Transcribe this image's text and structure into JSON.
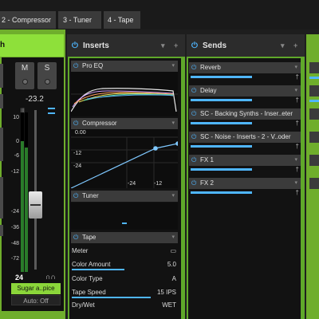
{
  "tabs": [
    {
      "label": "2 - Compressor"
    },
    {
      "label": "3 - Tuner"
    },
    {
      "label": "4 - Tape"
    }
  ],
  "channel": {
    "name_fragment": "h",
    "mute_label": "M",
    "solo_label": "S",
    "level_db": "-23.2",
    "meter_scale": [
      "10",
      "0",
      "-6",
      "-12",
      "-24",
      "-36",
      "-48",
      "-72"
    ],
    "volume_value": "24",
    "preset_name": "Sugar a..pice",
    "automation": "Auto: Off",
    "meter_left_level": 0.82,
    "meter_right_level": 0.78
  },
  "inserts": {
    "title": "Inserts",
    "plugins": [
      {
        "name": "Pro EQ"
      },
      {
        "name": "Compressor"
      },
      {
        "name": "Tuner"
      },
      {
        "name": "Tape"
      }
    ],
    "compressor_axis": {
      "top": "0.00",
      "y_ticks": [
        "-12",
        "-24"
      ],
      "x_ticks": [
        "-24",
        "-12"
      ]
    },
    "tape_params": [
      {
        "name": "Meter",
        "value": "▭",
        "level": 0
      },
      {
        "name": "Color Amount",
        "value": "5.0",
        "level": 0.5
      },
      {
        "name": "Color Type",
        "value": "A",
        "level": 0
      },
      {
        "name": "Tape Speed",
        "value": "15 IPS",
        "level": 0.75
      },
      {
        "name": "Dry/Wet",
        "value": "WET",
        "level": 0
      }
    ]
  },
  "sends": {
    "title": "Sends",
    "items": [
      {
        "name": "Reverb",
        "level": 0.55
      },
      {
        "name": "Delay",
        "level": 0.55
      },
      {
        "name": "SC - Backing Synths - Inser..eter",
        "level": 0.55
      },
      {
        "name": "SC - Noise - Inserts - 2 - V..oder",
        "level": 0.55
      },
      {
        "name": "FX 1",
        "level": 0.55
      },
      {
        "name": "FX 2",
        "level": 0.55
      }
    ]
  },
  "colors": {
    "accent_blue": "#4fb6ff",
    "strip_green": "#6fae2c",
    "strip_highlight": "#8ee03a"
  }
}
